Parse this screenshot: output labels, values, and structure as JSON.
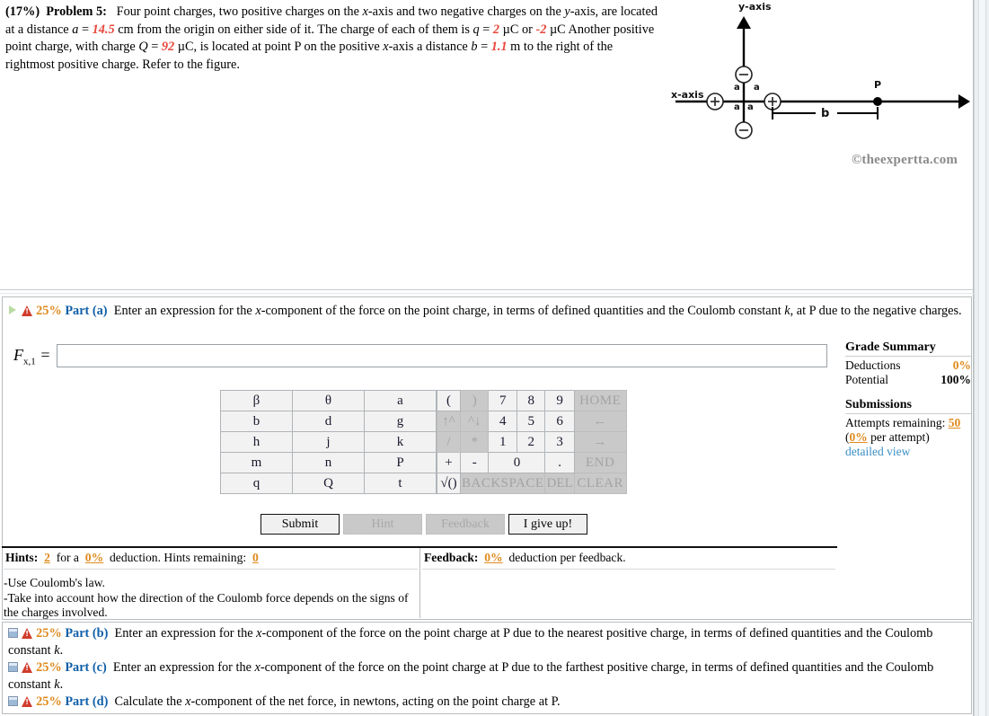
{
  "problem": {
    "percent": "(17%)",
    "label": "Problem 5:",
    "text_1": "Four point charges, two positive charges on the ",
    "x_axis_ital": "x",
    "text_2": "-axis and two negative charges on the ",
    "y_axis_ital": "y",
    "text_3": "-axis, are located at a distance ",
    "a_sym": "a",
    "eq": " = ",
    "a_val": "14.5",
    "text_4": " cm from the origin on either side of it. The charge of each of them is ",
    "q_sym": "q",
    "q_val": "2",
    "text_5": " µC or ",
    "q_neg_val": "-2",
    "text_6": " µC Another positive point charge, with charge ",
    "Q_sym": "Q",
    "Q_val": "92",
    "text_7": " µC, is located at point P on the positive ",
    "text_8": "-axis a distance ",
    "b_sym": "b",
    "b_val": "1.1",
    "text_9": " m to the right of the rightmost positive charge. Refer to the figure."
  },
  "figure": {
    "y_axis_label": "y-axis",
    "x_axis_label": "x-axis",
    "point_label": "P",
    "distance_a": "a",
    "distance_b": "b",
    "positive_sign": "+",
    "negative_sign": "−",
    "copyright": "©theexpertta.com"
  },
  "part_a": {
    "play_icon": "play-icon",
    "warn_icon": "warning-icon",
    "percent": "25%",
    "name": "Part (a)",
    "prompt_1": "Enter an expression for the ",
    "prompt_x": "x",
    "prompt_2": "-component of the force on the point charge, in terms of defined quantities and the Coulomb constant ",
    "prompt_k": "k",
    "prompt_3": ", at P due to the negative charges.",
    "answer_label_base": "F",
    "answer_label_sub": "x,1",
    "answer_equals": "=",
    "answer_value": "",
    "answer_placeholder": ""
  },
  "grade_summary": {
    "title": "Grade Summary",
    "rows": [
      {
        "label": "Deductions",
        "value": "0%",
        "accent": true
      },
      {
        "label": "Potential",
        "value": "100%",
        "accent": false
      }
    ],
    "submissions_title": "Submissions",
    "attempts_label": "Attempts remaining:",
    "attempts_value": "50",
    "per_attempt_value": "0%",
    "per_attempt_text": " per attempt)",
    "per_attempt_open": "(",
    "detailed_view": "detailed view"
  },
  "keypad": {
    "left_grid": [
      [
        {
          "label": "β",
          "disabled": false
        },
        {
          "label": "θ",
          "disabled": false
        },
        {
          "label": "a",
          "disabled": false
        }
      ],
      [
        {
          "label": "b",
          "disabled": false
        },
        {
          "label": "d",
          "disabled": false
        },
        {
          "label": "g",
          "disabled": false
        }
      ],
      [
        {
          "label": "h",
          "disabled": false
        },
        {
          "label": "j",
          "disabled": false
        },
        {
          "label": "k",
          "disabled": false
        }
      ],
      [
        {
          "label": "m",
          "disabled": false
        },
        {
          "label": "n",
          "disabled": false
        },
        {
          "label": "P",
          "disabled": false
        }
      ],
      [
        {
          "label": "q",
          "disabled": false
        },
        {
          "label": "Q",
          "disabled": false
        },
        {
          "label": "t",
          "disabled": false
        }
      ]
    ],
    "row1": [
      {
        "label": "(",
        "disabled": false
      },
      {
        "label": ")",
        "disabled": true
      },
      {
        "label": "7",
        "disabled": false
      },
      {
        "label": "8",
        "disabled": false
      },
      {
        "label": "9",
        "disabled": false
      },
      {
        "label": "HOME",
        "disabled": true
      }
    ],
    "row2": [
      {
        "label": "↑^",
        "disabled": true
      },
      {
        "label": "^↓",
        "disabled": true
      },
      {
        "label": "4",
        "disabled": false
      },
      {
        "label": "5",
        "disabled": false
      },
      {
        "label": "6",
        "disabled": false
      },
      {
        "label": "←",
        "disabled": true
      }
    ],
    "row3": [
      {
        "label": "/",
        "disabled": true
      },
      {
        "label": "*",
        "disabled": true
      },
      {
        "label": "1",
        "disabled": false
      },
      {
        "label": "2",
        "disabled": false
      },
      {
        "label": "3",
        "disabled": false
      },
      {
        "label": "→",
        "disabled": true
      }
    ],
    "row4": [
      {
        "label": "+",
        "disabled": false
      },
      {
        "label": "-",
        "disabled": false
      },
      {
        "label": "0",
        "disabled": false
      },
      {
        "label": ".",
        "disabled": false
      },
      {
        "label": "END",
        "disabled": true
      }
    ],
    "row5": [
      {
        "label": "√()",
        "disabled": false
      },
      {
        "label": "BACKSPACE",
        "disabled": true
      },
      {
        "label": "DEL",
        "disabled": true
      },
      {
        "label": "CLEAR",
        "disabled": true
      }
    ]
  },
  "actions": [
    {
      "label": "Submit",
      "disabled": false
    },
    {
      "label": "Hint",
      "disabled": true
    },
    {
      "label": "Feedback",
      "disabled": true
    },
    {
      "label": "I give up!",
      "disabled": false
    }
  ],
  "hints": {
    "title": "Hints:",
    "count": "2",
    "for_a": "for a",
    "deduction_pct": "0%",
    "deduction_text": "deduction. Hints remaining:",
    "remaining": "0",
    "body_line_1": "-Use Coulomb's law.",
    "body_line_2": "-Take into account how the direction of the Coulomb force depends on the signs of the charges involved."
  },
  "feedback": {
    "title": "Feedback:",
    "deduction_pct": "0%",
    "text": "deduction per feedback.",
    "body": ""
  },
  "parts_bcd": [
    {
      "icon": "panel-icon",
      "percent": "25%",
      "name": "Part (b)",
      "t1": "Enter an expression for the ",
      "x": "x",
      "t2": "-component of the force on the point charge at P due to the nearest positive charge, in terms of defined quantities and the Coulomb constant ",
      "k": "k",
      "t3": "."
    },
    {
      "icon": "panel-icon",
      "percent": "25%",
      "name": "Part (c)",
      "t1": "Enter an expression for the ",
      "x": "x",
      "t2": "-component of the force on the point charge at P due to the farthest positive charge, in terms of defined quantities and the Coulomb constant ",
      "k": "k",
      "t3": "."
    },
    {
      "icon": "panel-icon",
      "percent": "25%",
      "name": "Part (d)",
      "t1": "Calculate the ",
      "x": "x",
      "t2": "-component of the net force, in newtons, acting on the point charge at P.",
      "k": "",
      "t3": ""
    }
  ],
  "colors": {
    "accent_orange": "#e08a1e",
    "part_blue": "#0f5fa8",
    "red_value": "#e8483c",
    "link_blue": "#3a8fc4"
  }
}
